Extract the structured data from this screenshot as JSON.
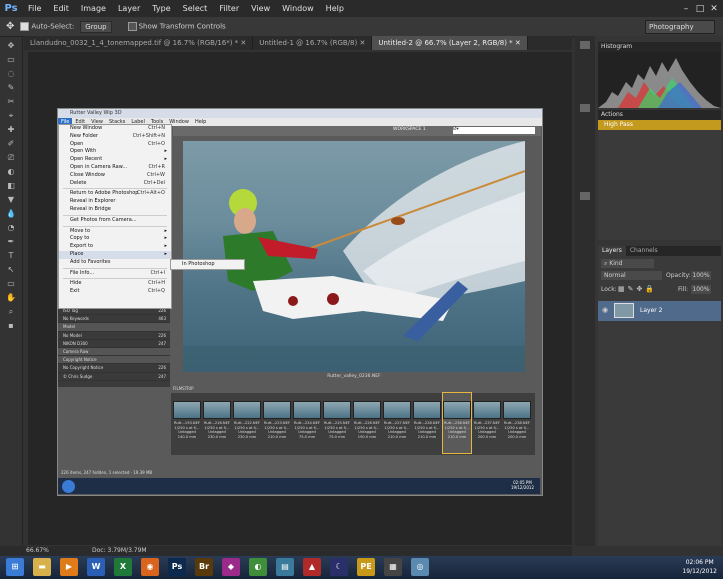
{
  "app": {
    "menu": [
      "File",
      "Edit",
      "Image",
      "Layer",
      "Type",
      "Select",
      "Filter",
      "View",
      "Window",
      "Help"
    ],
    "window_controls": [
      "–",
      "□",
      "✕"
    ]
  },
  "options_bar": {
    "auto_select_label": "Auto-Select:",
    "auto_select_value": "Group",
    "show_transform_label": "Show Transform Controls",
    "workspace": "Photography"
  },
  "doc_tabs": [
    {
      "label": "Llandudno_0032_1_4_tonemapped.tif @ 16.7% (RGB/16*) *",
      "active": false
    },
    {
      "label": "Untitled-1 @ 16.7% (RGB/8)",
      "active": false
    },
    {
      "label": "Untitled-2 @ 66.7% (Layer 2, RGB/8) *",
      "active": true
    }
  ],
  "status": {
    "zoom": "66.67%",
    "doc": "Doc: 3.79M/3.79M"
  },
  "panels": {
    "histogram": "Histogram",
    "actions": "Actions",
    "action_item": "High Pass",
    "layers_tab": "Layers",
    "channels_tab": "Channels",
    "kind": "Kind",
    "blend": "Normal",
    "opacity_label": "Opacity:",
    "opacity": "100%",
    "lock_label": "Lock:",
    "fill_label": "Fill:",
    "fill": "100%",
    "layer_name": "Layer 2"
  },
  "bridge": {
    "title": "Rutter Valley Wip 3D",
    "menu": [
      "File",
      "Edit",
      "View",
      "Stacks",
      "Label",
      "Tools",
      "Window",
      "Help"
    ],
    "workspace": "WORKSPACE 1",
    "search": "Ø▾",
    "photo_caption": "Rutter_valley_0236.NEF",
    "filmstrip_label": "FILMSTRIP",
    "status_text": "226 items, 247 hidden, 1 selected · 19.39 MB"
  },
  "file_menu": [
    {
      "label": "New Window",
      "sc": "Ctrl+N"
    },
    {
      "label": "New Folder",
      "sc": "Ctrl+Shift+N"
    },
    {
      "label": "Open",
      "sc": "Ctrl+O"
    },
    {
      "label": "Open With",
      "arrow": "▸"
    },
    {
      "label": "Open Recent",
      "arrow": "▸"
    },
    {
      "label": "Open in Camera Raw...",
      "sc": "Ctrl+R"
    },
    {
      "label": "Close Window",
      "sc": "Ctrl+W"
    },
    {
      "label": "Delete",
      "sc": "Ctrl+Del"
    },
    {
      "sep": true
    },
    {
      "label": "Return to Adobe Photoshop",
      "sc": "Ctrl+Alt+O"
    },
    {
      "label": "Reveal in Explorer"
    },
    {
      "label": "Reveal in Bridge"
    },
    {
      "sep": true
    },
    {
      "label": "Get Photos from Camera..."
    },
    {
      "sep": true
    },
    {
      "label": "Move to",
      "arrow": "▸"
    },
    {
      "label": "Copy to",
      "arrow": "▸"
    },
    {
      "label": "Export to",
      "arrow": "▸"
    },
    {
      "label": "Place",
      "arrow": "▸",
      "hl": true
    },
    {
      "label": "Add to Favorites"
    },
    {
      "sep": true
    },
    {
      "label": "File Info...",
      "sc": "Ctrl+I"
    },
    {
      "sep": true
    },
    {
      "label": "Hide",
      "sc": "Ctrl+H"
    },
    {
      "label": "Exit",
      "sc": "Ctrl+Q"
    }
  ],
  "submenu_item": "In Photoshop",
  "meta_rows": [
    {
      "l": "ISO Tag",
      "v": "226"
    },
    {
      "l": "No Keywords",
      "v": "463"
    },
    {
      "l": "Model",
      "v": "",
      "head": true
    },
    {
      "l": "No Model",
      "v": "226"
    },
    {
      "l": "NIKON D300",
      "v": "247"
    },
    {
      "l": "Camera Raw",
      "v": "",
      "head": true
    },
    {
      "l": "Copyright Notice",
      "v": "",
      "head": true
    },
    {
      "l": "No Copyright Notice",
      "v": "226"
    },
    {
      "l": "© Chris Sudge",
      "v": "247"
    }
  ],
  "thumbs": [
    {
      "lbl": "Rutt...193.NEF\n1/250 s at f/...\nUntagged\n140.0 mm"
    },
    {
      "lbl": "Rutt...216.NEF\n1/250 s at f/...\nUntagged\n230.0 mm"
    },
    {
      "lbl": "Rutt...222.NEF\n1/250 s at f/...\nUntagged\n230.0 mm"
    },
    {
      "lbl": "Rutt...223.NEF\n1/250 s at f/...\nUntagged\n210.0 mm"
    },
    {
      "lbl": "Rutt...224.NEF\n1/250 s at f/...\nUntagged\n75.0 mm"
    },
    {
      "lbl": "Rutt...225.NEF\n1/250 s at f/...\nUntagged\n75.0 mm"
    },
    {
      "lbl": "Rutt...226.NEF\n1/250 s at f/...\nUntagged\n190.0 mm"
    },
    {
      "lbl": "Rutt...227.NEF\n1/250 s at f/...\nUntagged\n210.0 mm"
    },
    {
      "lbl": "Rutt...228.NEF\n1/250 s at f/...\nUntagged\n210.0 mm"
    },
    {
      "lbl": "Rutt...236.NEF\n1/250 s at f/...\nUntagged\n210.0 mm",
      "sel": true
    },
    {
      "lbl": "Rutt...237.NEF\n1/250 s at f/...\nUntagged\n200.0 mm"
    },
    {
      "lbl": "Rutt...238.NEF\n1/250 s at f/...\nUntagged\n200.0 mm"
    }
  ],
  "clock": {
    "time": "02:06 PM",
    "date": "19/12/2012"
  },
  "bridge_clock": {
    "time": "02:05 PM",
    "date": "19/12/2012"
  },
  "taskbar_icons": [
    {
      "name": "start-orb-icon",
      "glyph": "⊞",
      "color": "#3a7bd5"
    },
    {
      "name": "folder-icon",
      "glyph": "▬",
      "color": "#d9b14a"
    },
    {
      "name": "media-player-icon",
      "glyph": "▶",
      "color": "#e07b1a"
    },
    {
      "name": "word-icon",
      "glyph": "W",
      "color": "#2b5fb5"
    },
    {
      "name": "excel-icon",
      "glyph": "X",
      "color": "#1f7a3a"
    },
    {
      "name": "firefox-icon",
      "glyph": "◉",
      "color": "#d8641d"
    },
    {
      "name": "photoshop-icon",
      "glyph": "Ps",
      "color": "#0b2a4e"
    },
    {
      "name": "bridge-icon",
      "glyph": "Br",
      "color": "#5a3a0a"
    },
    {
      "name": "app-purple-icon",
      "glyph": "◆",
      "color": "#9b2a8a"
    },
    {
      "name": "app-green-icon",
      "glyph": "◐",
      "color": "#3f8f3a"
    },
    {
      "name": "app-map-icon",
      "glyph": "▤",
      "color": "#3a7a9a"
    },
    {
      "name": "app-red-icon",
      "glyph": "▲",
      "color": "#b02a2a"
    },
    {
      "name": "app-night-icon",
      "glyph": "☾",
      "color": "#2a2f6a"
    },
    {
      "name": "app-pe-icon",
      "glyph": "PE",
      "color": "#c99a1a"
    },
    {
      "name": "app-film-icon",
      "glyph": "▦",
      "color": "#444"
    },
    {
      "name": "app-globe-icon",
      "glyph": "◎",
      "color": "#5a8ab0"
    }
  ]
}
